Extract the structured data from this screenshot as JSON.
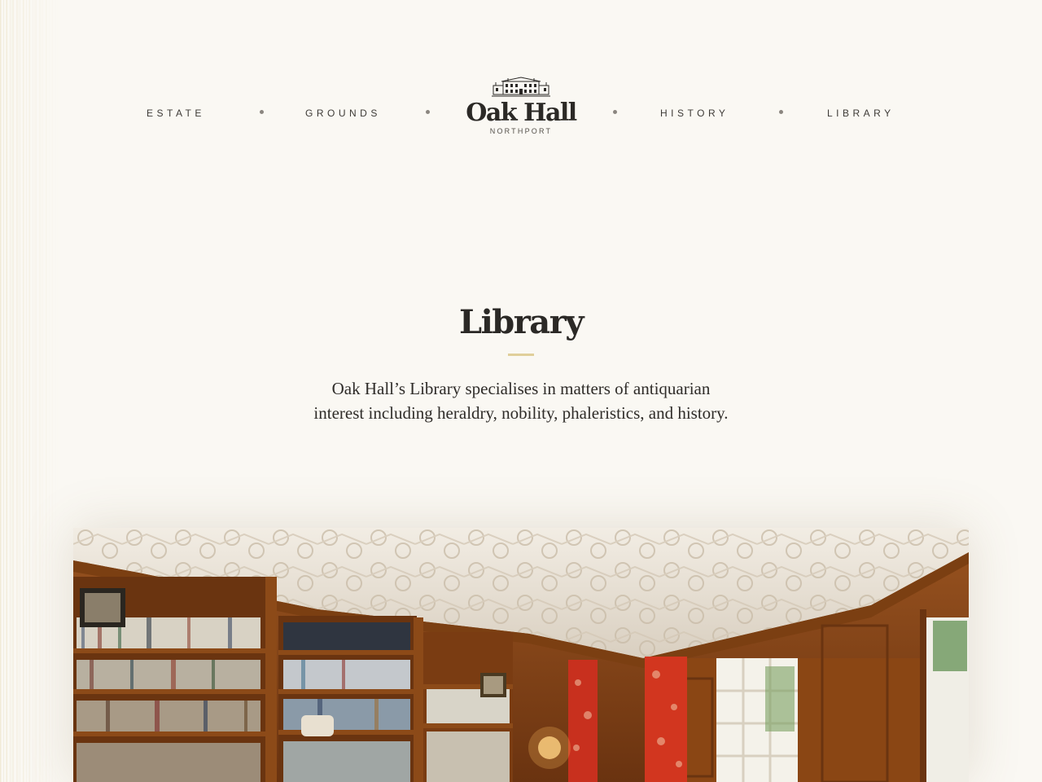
{
  "nav": {
    "left": [
      {
        "label": "ESTATE"
      },
      {
        "label": "GROUNDS"
      }
    ],
    "right": [
      {
        "label": "HISTORY"
      },
      {
        "label": "LIBRARY"
      }
    ]
  },
  "logo": {
    "title": "Oak Hall",
    "subtitle": "NORTHPORT",
    "icon": "manor-house-icon"
  },
  "page": {
    "title": "Library",
    "intro": "Oak Hall’s Library specialises in matters of antiquarian interest including heraldry, nobility, phaleristics, and history."
  },
  "hero": {
    "icon": "library-interior-photo"
  },
  "colors": {
    "background": "#faf8f3",
    "text": "#2b2926",
    "accent": "#e0cf9a",
    "wood": "#8a4a18"
  }
}
